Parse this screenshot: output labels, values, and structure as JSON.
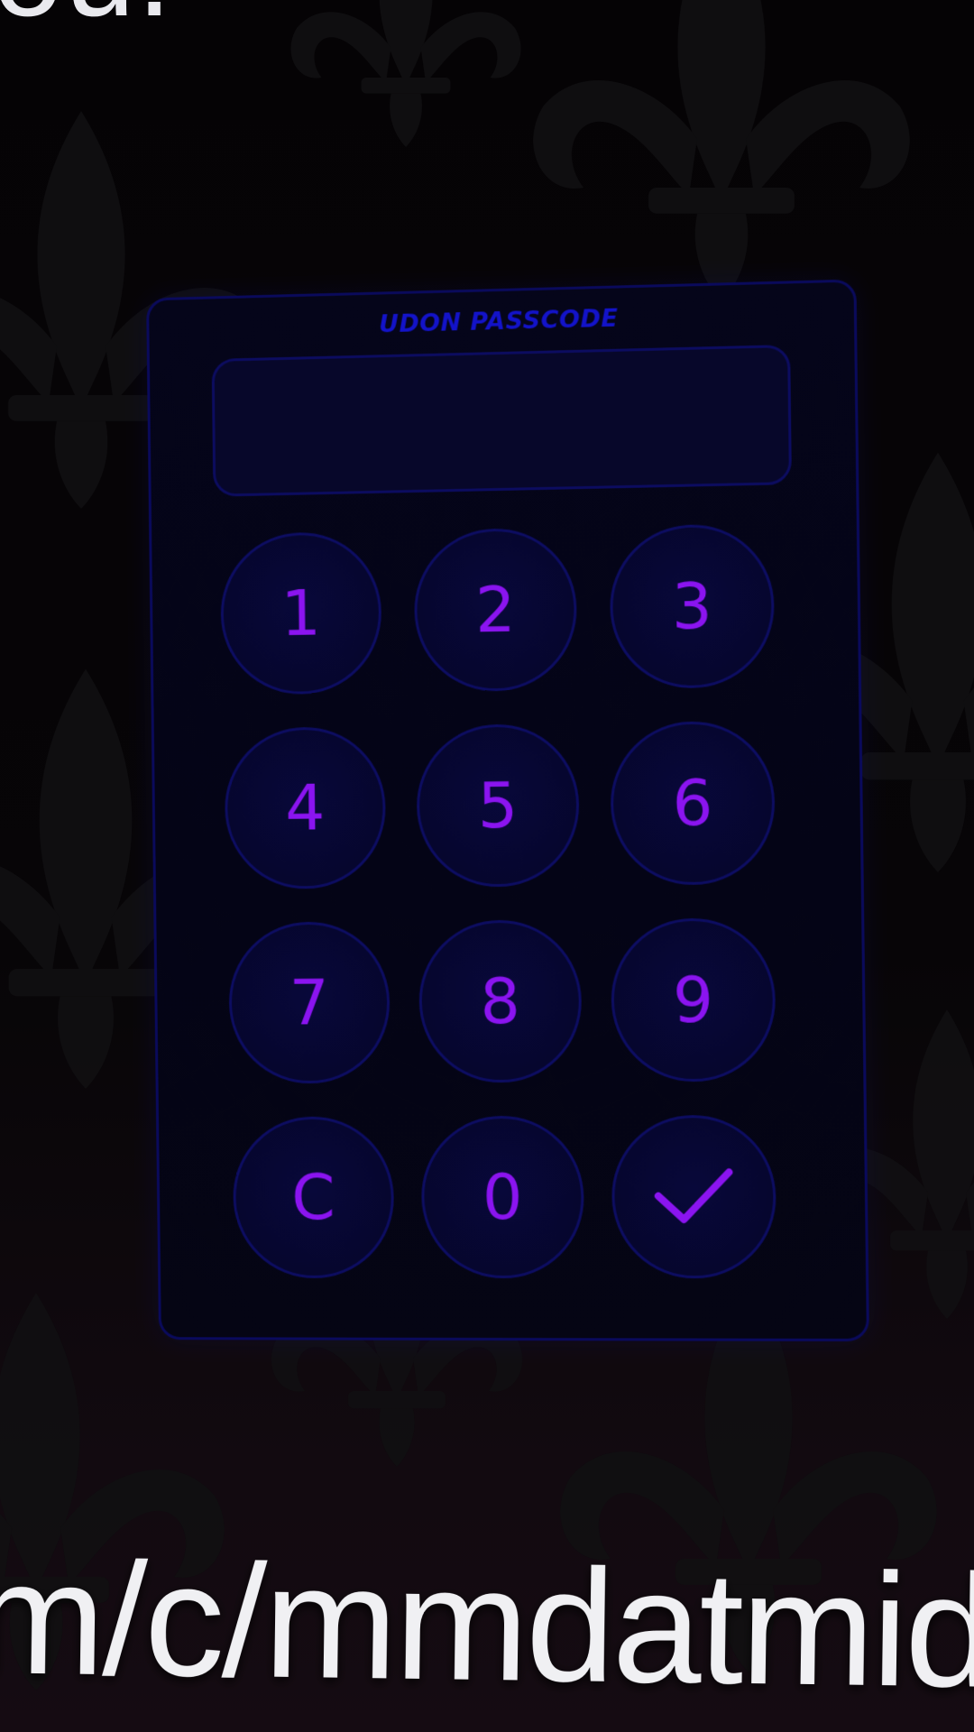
{
  "background": {
    "top_text": "ou.",
    "bottom_text": "m/c/mmdatmid"
  },
  "keypad": {
    "title": "UDON PASSCODE",
    "display_value": "",
    "keys": [
      "1",
      "2",
      "3",
      "4",
      "5",
      "6",
      "7",
      "8",
      "9",
      "C",
      "0"
    ],
    "confirm_icon": "checkmark-icon"
  },
  "colors": {
    "accent": "#8b14f0",
    "title": "#1313c9",
    "border": "#0d0d62",
    "panel": "#040416"
  }
}
